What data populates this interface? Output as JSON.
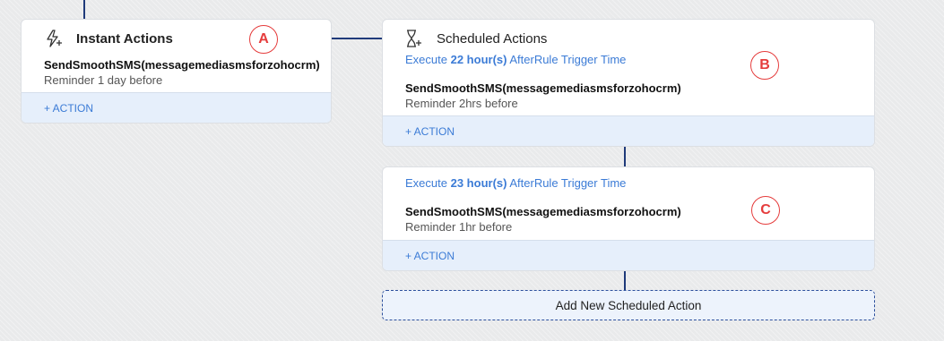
{
  "instant_card": {
    "title": "Instant Actions",
    "icon": "lightning-plus-icon",
    "action_name": "SendSmoothSMS(messagemediasmsforzohocrm)",
    "action_desc": "Reminder 1 day before",
    "add_action_label": "+ ACTION",
    "marker": "A"
  },
  "scheduled_card_1": {
    "title": "Scheduled Actions",
    "icon": "hourglass-plus-icon",
    "exec_prefix": "Execute",
    "exec_duration": "22 hour(s)",
    "exec_suffix": "AfterRule Trigger Time",
    "action_name": "SendSmoothSMS(messagemediasmsforzohocrm)",
    "action_desc": "Reminder 2hrs before",
    "add_action_label": "+ ACTION",
    "marker": "B"
  },
  "scheduled_card_2": {
    "exec_prefix": "Execute",
    "exec_duration": "23 hour(s)",
    "exec_suffix": "AfterRule Trigger Time",
    "action_name": "SendSmoothSMS(messagemediasmsforzohocrm)",
    "action_desc": "Reminder 1hr before",
    "add_action_label": "+ ACTION",
    "marker": "C"
  },
  "add_new_scheduled_label": "Add New Scheduled Action",
  "colors": {
    "connector": "#1f3a7a",
    "link_blue": "#3b7bd6",
    "marker_red": "#e53c3c",
    "action_bar_bg": "#e6effb"
  }
}
